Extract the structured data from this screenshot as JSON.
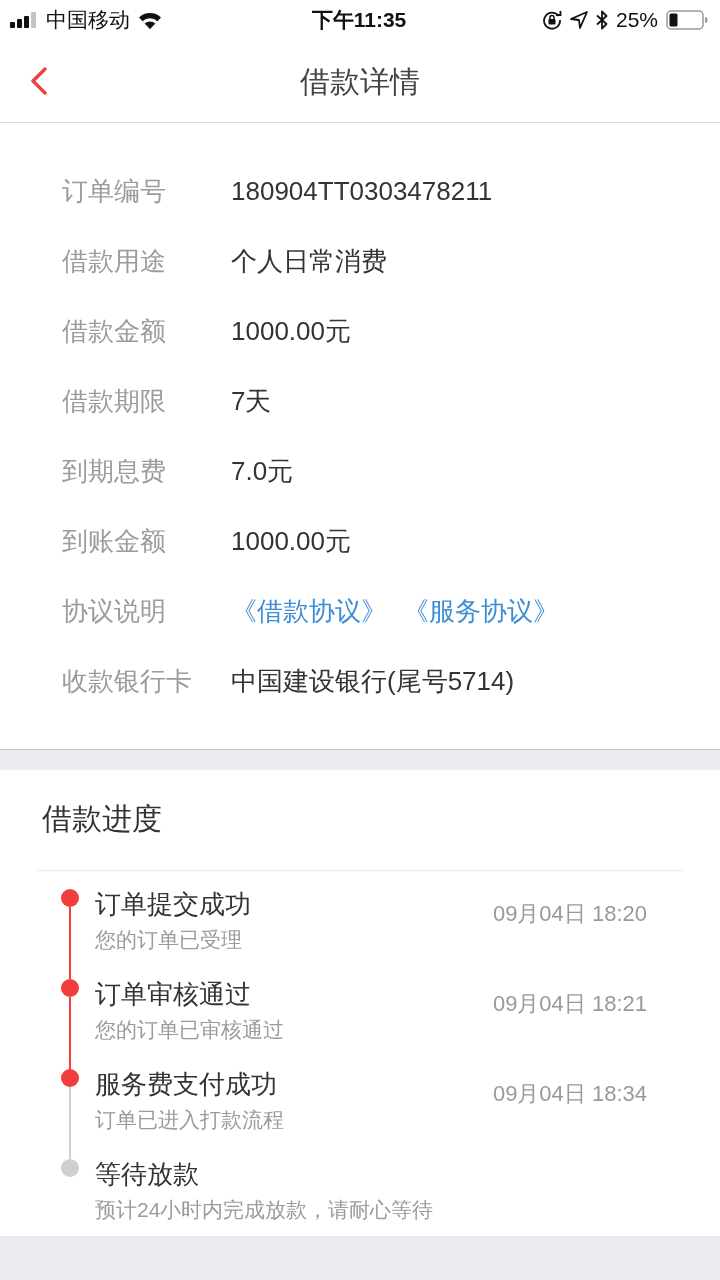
{
  "status_bar": {
    "carrier": "中国移动",
    "time": "下午11:35",
    "battery": "25%"
  },
  "header": {
    "title": "借款详情"
  },
  "details": [
    {
      "kind": "text",
      "label": "订单编号",
      "value": "180904TT0303478211"
    },
    {
      "kind": "text",
      "label": "借款用途",
      "value": "个人日常消费"
    },
    {
      "kind": "text",
      "label": "借款金额",
      "value": "1000.00元"
    },
    {
      "kind": "text",
      "label": "借款期限",
      "value": "7天"
    },
    {
      "kind": "text",
      "label": "到期息费",
      "value": "7.0元"
    },
    {
      "kind": "text",
      "label": "到账金额",
      "value": "1000.00元"
    },
    {
      "kind": "links",
      "label": "协议说明",
      "links": [
        "《借款协议》",
        "《服务协议》"
      ]
    },
    {
      "kind": "text",
      "label": "收款银行卡",
      "value": "中国建设银行(尾号5714)"
    }
  ],
  "progress": {
    "title": "借款进度",
    "steps": [
      {
        "title": "订单提交成功",
        "note": "您的订单已受理",
        "time": "09月04日 18:20",
        "done": true
      },
      {
        "title": "订单审核通过",
        "note": "您的订单已审核通过",
        "time": "09月04日 18:21",
        "done": true
      },
      {
        "title": "服务费支付成功",
        "note": "订单已进入打款流程",
        "time": "09月04日 18:34",
        "done": true
      },
      {
        "title": "等待放款",
        "note": "预计24小时内完成放款，请耐心等待",
        "done": false
      }
    ]
  }
}
